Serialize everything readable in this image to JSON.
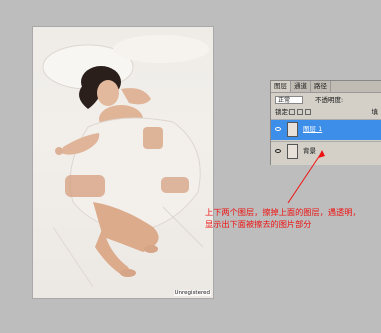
{
  "panel": {
    "tabs": [
      {
        "label": "图层"
      },
      {
        "label": "通道"
      },
      {
        "label": "路径"
      }
    ],
    "blend_mode": "正常",
    "opacity_label": "不透明度:",
    "lock_label": "锁定:",
    "fill_label": "填",
    "layers": [
      {
        "name": "图层 1",
        "selected": true
      },
      {
        "name": "背景",
        "selected": false
      }
    ]
  },
  "annotation": {
    "text": "上下两个图层，擦掉上面的图层，遇透明，显示出下面被擦去的图片部分"
  },
  "photo": {
    "watermark": "Unregistered"
  }
}
